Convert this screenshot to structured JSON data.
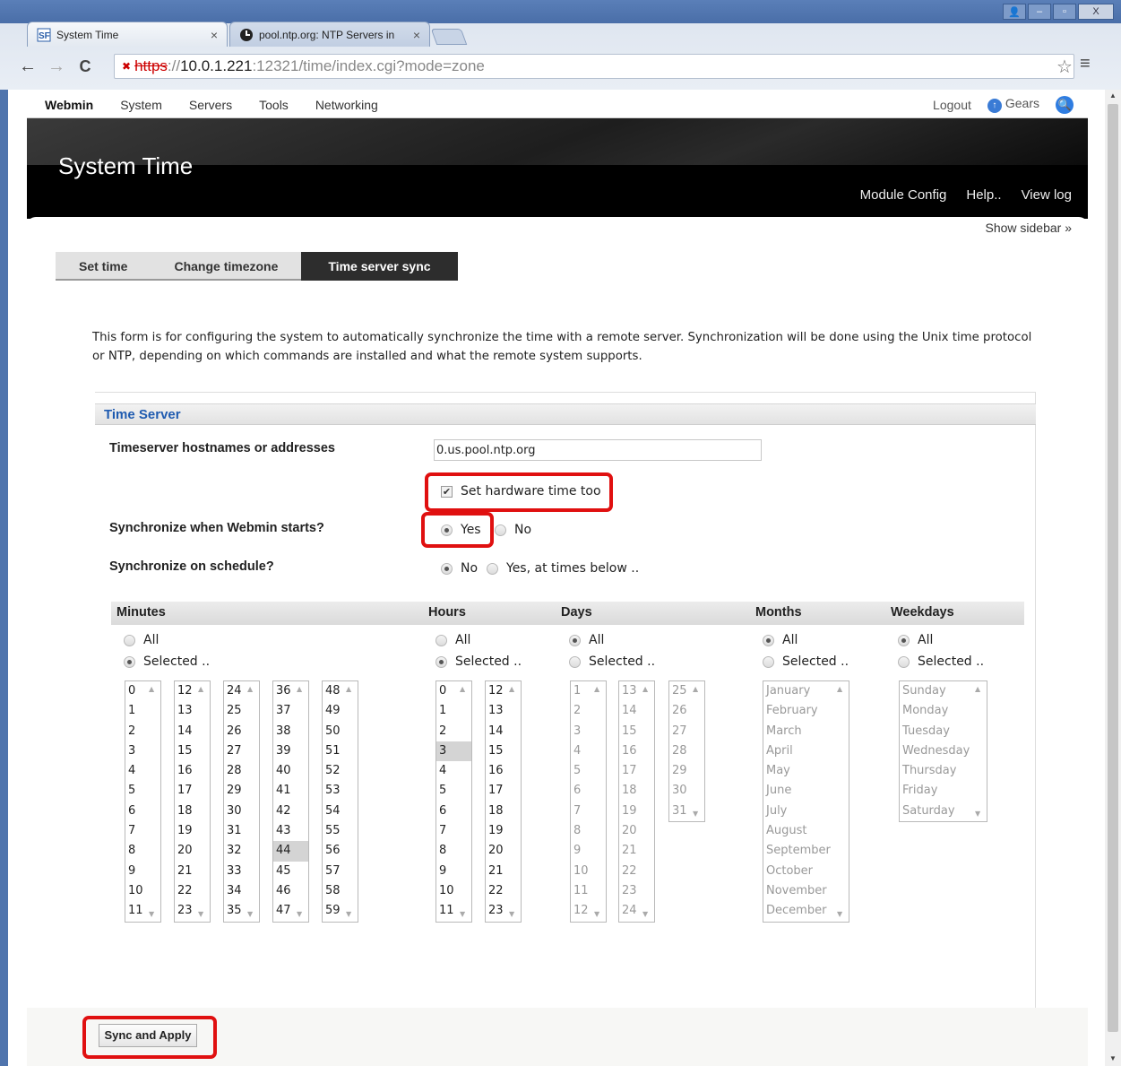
{
  "browser": {
    "tabs": [
      {
        "title": "System Time",
        "favicon": "webmin-favicon"
      },
      {
        "title": "pool.ntp.org: NTP Servers in",
        "favicon": "ntp-favicon"
      }
    ],
    "url_scheme": "https",
    "url_sep": "://",
    "url_host": "10.0.1.221",
    "url_path": ":12321/time/index.cgi?mode=zone",
    "tab_close": "×",
    "nav": {
      "back": "←",
      "forward": "→",
      "reload": "C"
    },
    "star": "☆",
    "menu": "≡",
    "window_controls": {
      "user": "👤",
      "minimize": "–",
      "maximize": "▫",
      "close": "X"
    }
  },
  "topbar": {
    "brand": "Webmin",
    "menus": [
      "System",
      "Servers",
      "Tools",
      "Networking"
    ],
    "logout": "Logout",
    "gears": "Gears",
    "gears_glyph": "↑",
    "search_glyph": "🔍"
  },
  "header": {
    "title": "System Time",
    "links": [
      "Module Config",
      "Help..",
      "View log"
    ]
  },
  "show_sidebar": "Show sidebar »",
  "page_tabs": [
    {
      "label": "Set time",
      "active": false
    },
    {
      "label": "Change timezone",
      "active": false
    },
    {
      "label": "Time server sync",
      "active": true
    }
  ],
  "intro": "This form is for configuring the system to automatically synchronize the time with a remote server. Synchronization will be done using the Unix time protocol or NTP, depending on which commands are installed and what the remote system supports.",
  "form": {
    "section_title": "Time Server",
    "hostnames_label": "Timeserver hostnames or addresses",
    "hostnames_value": "0.us.pool.ntp.org",
    "hardware_label": "Set hardware time too",
    "hardware_checked": true,
    "webmin_start_label": "Synchronize when Webmin starts?",
    "webmin_start_yes": "Yes",
    "webmin_start_no": "No",
    "webmin_start_value": "Yes",
    "schedule_label": "Synchronize on schedule?",
    "schedule_no": "No",
    "schedule_yes": "Yes, at times below ..",
    "schedule_value": "No"
  },
  "schedule": {
    "headers": [
      "Minutes",
      "Hours",
      "Days",
      "Months",
      "Weekdays"
    ],
    "all_label": "All",
    "selected_label": "Selected ..",
    "minutes_mode": "Selected ..",
    "hours_mode": "Selected ..",
    "days_mode": "All",
    "months_mode": "All",
    "weekdays_mode": "All",
    "minutes_selected": [
      "44"
    ],
    "hours_selected": [
      "3"
    ],
    "months": [
      "January",
      "February",
      "March",
      "April",
      "May",
      "June",
      "July",
      "August",
      "September",
      "October",
      "November",
      "December"
    ],
    "weekdays": [
      "Sunday",
      "Monday",
      "Tuesday",
      "Wednesday",
      "Thursday",
      "Friday",
      "Saturday"
    ]
  },
  "submit_label": "Sync and Apply",
  "colors": {
    "highlight": "#e01010",
    "link": "#1f5bb0",
    "header_bg": "#000000"
  }
}
